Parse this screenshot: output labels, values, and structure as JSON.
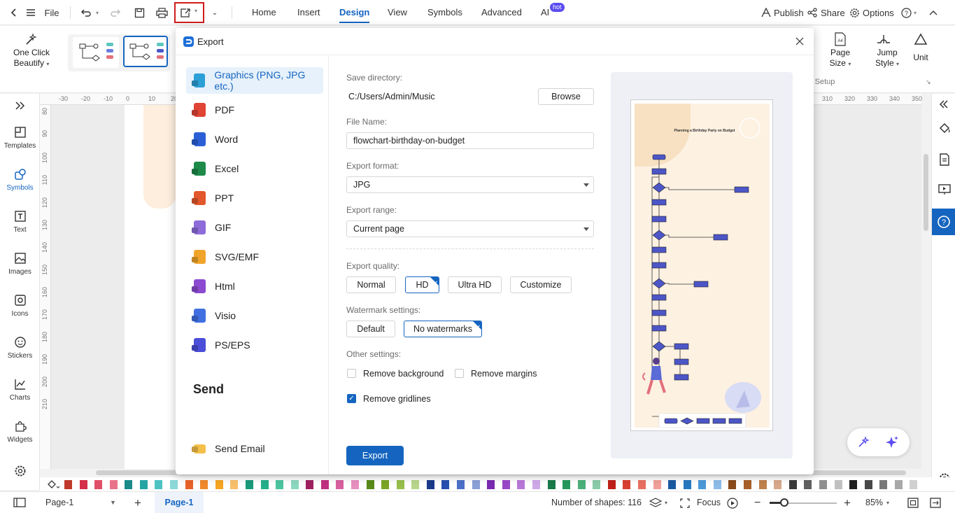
{
  "toolbar": {
    "file_label": "File",
    "tabs": [
      "Home",
      "Insert",
      "Design",
      "View",
      "Symbols",
      "Advanced",
      "AI"
    ],
    "ai_badge": "hot",
    "publish_label": "Publish",
    "share_label": "Share",
    "options_label": "Options"
  },
  "ribbon": {
    "beautify_label_1": "One Click",
    "beautify_label_2": "Beautify",
    "page_size_1": "Page",
    "page_size_2": "Size",
    "jump_style_1": "Jump",
    "jump_style_2": "Style",
    "unit_label": "Unit",
    "setup_label": "Setup"
  },
  "left_panel": {
    "items": [
      "Templates",
      "Symbols",
      "Text",
      "Images",
      "Icons",
      "Stickers",
      "Charts",
      "Widgets"
    ]
  },
  "rulers": {
    "h_ticks": [
      "-30",
      "-20",
      "-10",
      "0",
      "10",
      "20",
      "310",
      "320",
      "330",
      "340",
      "350"
    ],
    "v_ticks": [
      "80",
      "90",
      "100",
      "110",
      "120",
      "130",
      "140",
      "150",
      "160",
      "170",
      "180",
      "190",
      "200",
      "210"
    ]
  },
  "dialog": {
    "title": "Export",
    "nav": [
      {
        "label": "Graphics (PNG, JPG etc.)",
        "color": "#2b9fd6"
      },
      {
        "label": "PDF",
        "color": "#e04434"
      },
      {
        "label": "Word",
        "color": "#2b5fd6"
      },
      {
        "label": "Excel",
        "color": "#1e8a4a"
      },
      {
        "label": "PPT",
        "color": "#e2572b"
      },
      {
        "label": "GIF",
        "color": "#8d6bd8"
      },
      {
        "label": "SVG/EMF",
        "color": "#f0a52a"
      },
      {
        "label": "Html",
        "color": "#8b4ad0"
      },
      {
        "label": "Visio",
        "color": "#3f6fe0"
      },
      {
        "label": "PS/EPS",
        "color": "#4a4ed8"
      }
    ],
    "send_heading": "Send",
    "send_email_label": "Send Email",
    "save_dir_label": "Save directory:",
    "save_dir_value": "C:/Users/Admin/Music",
    "browse_label": "Browse",
    "file_name_label": "File Name:",
    "file_name_value": "flowchart-birthday-on-budget",
    "format_label": "Export format:",
    "format_value": "JPG",
    "range_label": "Export range:",
    "range_value": "Current page",
    "quality_label": "Export quality:",
    "quality_options": [
      "Normal",
      "HD",
      "Ultra HD",
      "Customize"
    ],
    "watermark_label": "Watermark settings:",
    "watermark_options": [
      "Default",
      "No watermarks"
    ],
    "other_label": "Other settings:",
    "remove_background": "Remove background",
    "remove_margins": "Remove margins",
    "remove_gridlines": "Remove gridlines",
    "export_button": "Export",
    "preview_title": "Planning a Birthday Party on Budget"
  },
  "colors": {
    "accent": "#1565c0",
    "swatches": [
      "#c0392b",
      "#d4304a",
      "#e0506a",
      "#e8738a",
      "#1a8a8a",
      "#26a5a5",
      "#4cc2c2",
      "#8bd8d8",
      "#e8632b",
      "#f0892b",
      "#f5a623",
      "#f8c06b",
      "#1a9a7a",
      "#26b08a",
      "#4cc4a0",
      "#8bd8c0",
      "#a02060",
      "#c03080",
      "#d860a0",
      "#e890c0",
      "#5a8a1a",
      "#7aa626",
      "#98be4c",
      "#b8d68b",
      "#1a3a8a",
      "#2650b0",
      "#4c70c8",
      "#8ba0d8",
      "#7a2ab0",
      "#9a48c8",
      "#b878d8",
      "#d0a8e8",
      "#1a7a4a",
      "#26985c",
      "#4cb07a",
      "#8bcca8",
      "#c0201a",
      "#d84030",
      "#e87060",
      "#f0a098",
      "#1a5aa0",
      "#2678c0",
      "#4c98d8",
      "#8bbce8",
      "#8a4a1a",
      "#a8602a",
      "#c0804c",
      "#d8a88b",
      "#3a3a3a",
      "#606060",
      "#909090",
      "#c0c0c0",
      "#202020",
      "#484848",
      "#787878",
      "#a8a8a8",
      "#d0d0d0"
    ]
  },
  "status": {
    "page_name": "Page-1",
    "page_tab": "Page-1",
    "shapes_count": "Number of shapes: 116",
    "focus_label": "Focus",
    "zoom": "85%"
  }
}
